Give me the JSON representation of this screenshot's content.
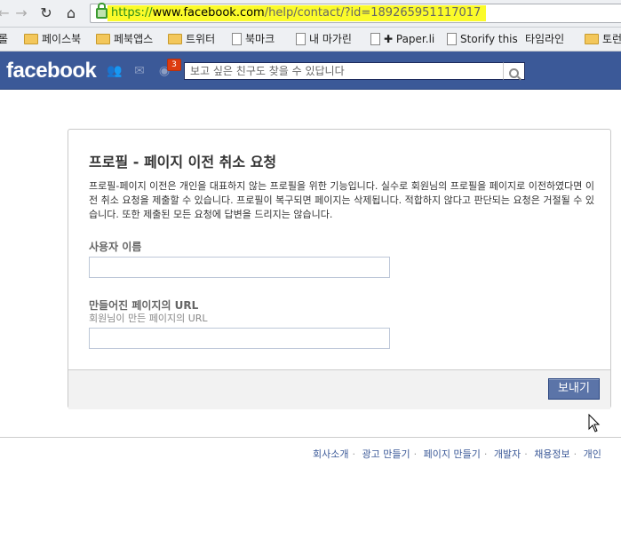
{
  "browser": {
    "url_scheme": "https://",
    "url_host": "www.facebook.com",
    "url_path": "/help/contact/?id=189265951117017",
    "bookmarks": [
      {
        "label": "롤",
        "type": "folder-cut"
      },
      {
        "label": "페이스북",
        "type": "folder"
      },
      {
        "label": "페북앱스",
        "type": "folder"
      },
      {
        "label": "트위터",
        "type": "folder"
      },
      {
        "label": "북마크",
        "type": "page"
      },
      {
        "label": "내 마가린",
        "type": "page"
      },
      {
        "label": "✚ Paper.li",
        "type": "page"
      },
      {
        "label": "Storify this",
        "type": "page"
      },
      {
        "label": "타임라인",
        "type": "page-cut"
      },
      {
        "label": "토런",
        "type": "folder"
      }
    ]
  },
  "fb": {
    "logo": "facebook",
    "notif_count": "3",
    "search_placeholder": "보고 싶은 친구도 찾을 수 있답니다"
  },
  "dialog": {
    "title": "프로필 - 페이지 이전 취소 요청",
    "description": "프로필-페이지 이전은 개인을 대표하지 않는 프로필을 위한 기능입니다. 실수로 회원님의 프로필을 페이지로 이전하였다면 이전 취소 요청을 제출할 수 있습니다. 프로필이 복구되면 페이지는 삭제됩니다. 적합하지 않다고 판단되는 요청은 거절될 수 있습니다. 또한 제출된 모든 요청에 답변을 드리지는 않습니다.",
    "username_label": "사용자 이름",
    "username_value": "",
    "url_label": "만들어진 페이지의 URL",
    "url_sublabel": "회원님이 만든 페이지의 URL",
    "url_value": "",
    "submit_label": "보내기"
  },
  "footer": {
    "links": [
      "회사소개",
      "광고 만들기",
      "페이지 만들기",
      "개발자",
      "채용정보",
      "개인"
    ]
  },
  "colors": {
    "fb_blue": "#3b5998",
    "url_highlight": "#fbfb2a",
    "badge_red": "#dd3c10"
  }
}
